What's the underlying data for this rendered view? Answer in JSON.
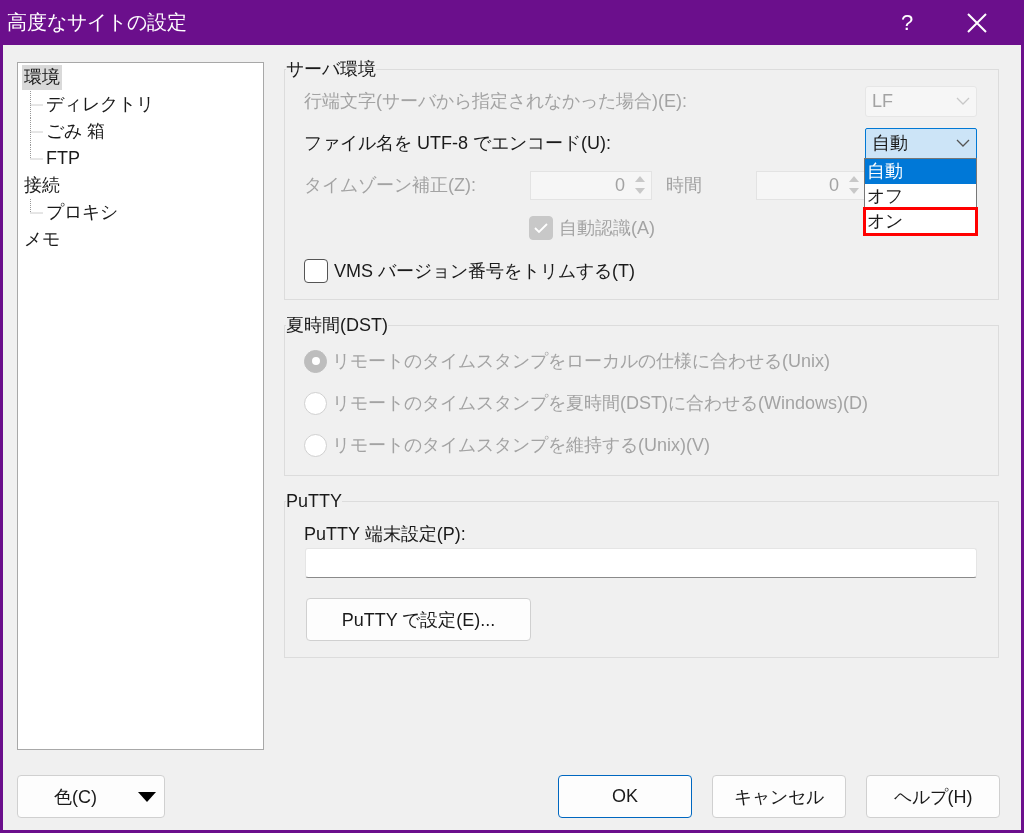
{
  "window": {
    "title": "高度なサイトの設定",
    "help_glyph": "?"
  },
  "tree": [
    {
      "label": "環境",
      "selected": true,
      "children": [
        {
          "label": "ディレクトリ",
          "selected": false
        },
        {
          "label": "ごみ 箱",
          "selected": false
        },
        {
          "label": "FTP",
          "selected": false
        }
      ]
    },
    {
      "label": "接続",
      "selected": false,
      "children": [
        {
          "label": "プロキシ",
          "selected": false
        }
      ]
    },
    {
      "label": "メモ",
      "selected": false
    }
  ],
  "server_group": {
    "title": "サーバ環境",
    "eol": {
      "label": "行端文字(サーバから指定されなかった場合)(E):",
      "value": "LF",
      "disabled": true
    },
    "utf8": {
      "label": "ファイル名を UTF-8 でエンコード(U):",
      "value": "自動",
      "disabled": false,
      "expanded": true,
      "options": [
        {
          "label": "自動",
          "selected": true,
          "highlighted": false
        },
        {
          "label": "オフ",
          "selected": false,
          "highlighted": false
        },
        {
          "label": "オン",
          "selected": false,
          "highlighted": true
        }
      ]
    },
    "timezone": {
      "label": "タイムゾーン補正(Z):",
      "hours": "0",
      "unit": "時間",
      "minutes": "0",
      "disabled": true
    },
    "auto_detect": {
      "label": "自動認識(A)",
      "checked": true,
      "disabled": true
    },
    "trim_vms": {
      "label": "VMS バージョン番号をトリムする(T)",
      "checked": false,
      "disabled": false
    }
  },
  "dst_group": {
    "title": "夏時間(DST)",
    "options": [
      {
        "label": "リモートのタイムスタンプをローカルの仕様に合わせる(Unix)",
        "selected": true,
        "disabled": true
      },
      {
        "label": "リモートのタイムスタンプを夏時間(DST)に合わせる(Windows)(D)",
        "selected": false,
        "disabled": true
      },
      {
        "label": "リモートのタイムスタンプを維持する(Unix)(V)",
        "selected": false,
        "disabled": true
      }
    ]
  },
  "putty_group": {
    "title": "PuTTY",
    "terminal_label": "PuTTY 端末設定(P):",
    "configure_button": "PuTTY で設定(E)..."
  },
  "footer": {
    "color_button": "色(C)",
    "buttons": [
      {
        "label": "OK",
        "default": true
      },
      {
        "label": "キャンセル",
        "default": false
      },
      {
        "label": "ヘルプ(H)",
        "default": false
      }
    ]
  }
}
